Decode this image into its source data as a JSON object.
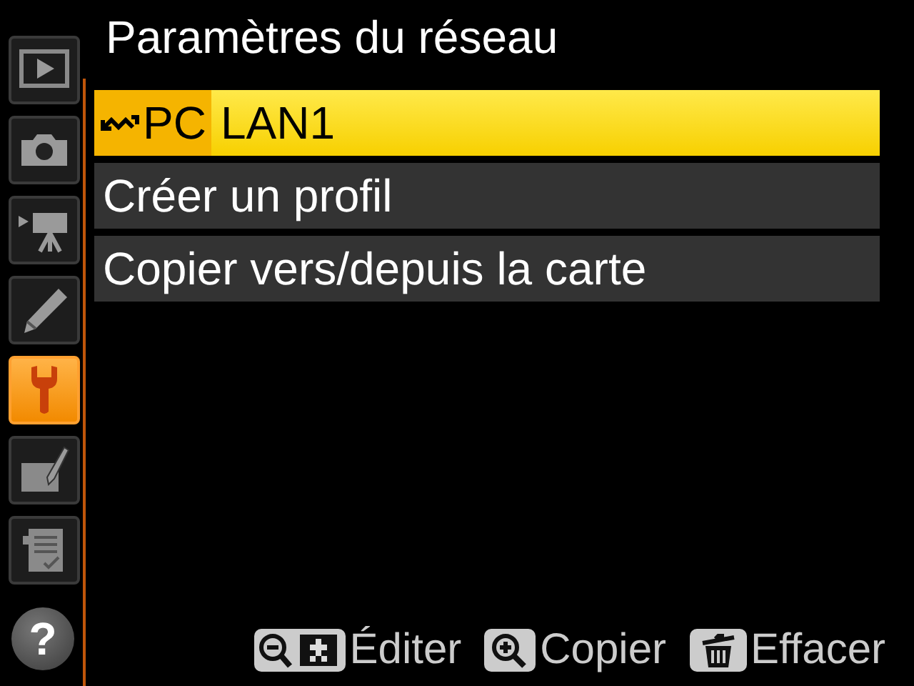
{
  "title": "Paramètres du réseau",
  "menu_tabs": [
    {
      "kind": "playback",
      "selected": false
    },
    {
      "kind": "camera",
      "selected": false
    },
    {
      "kind": "movie",
      "selected": false
    },
    {
      "kind": "custom",
      "selected": false
    },
    {
      "kind": "setup",
      "selected": true
    },
    {
      "kind": "retouch",
      "selected": false
    },
    {
      "kind": "recent",
      "selected": false
    }
  ],
  "help": "?",
  "items": [
    {
      "kind": "profile",
      "tag": "PC",
      "label": "LAN1",
      "selected": true
    },
    {
      "kind": "command",
      "label": "Créer un profil",
      "selected": false
    },
    {
      "kind": "command",
      "label": "Copier vers/depuis la carte",
      "selected": false
    }
  ],
  "footer": [
    {
      "kind": "zoom-out-grid",
      "label": "Éditer"
    },
    {
      "kind": "zoom-in",
      "label": "Copier"
    },
    {
      "kind": "trash",
      "label": "Effacer"
    }
  ]
}
